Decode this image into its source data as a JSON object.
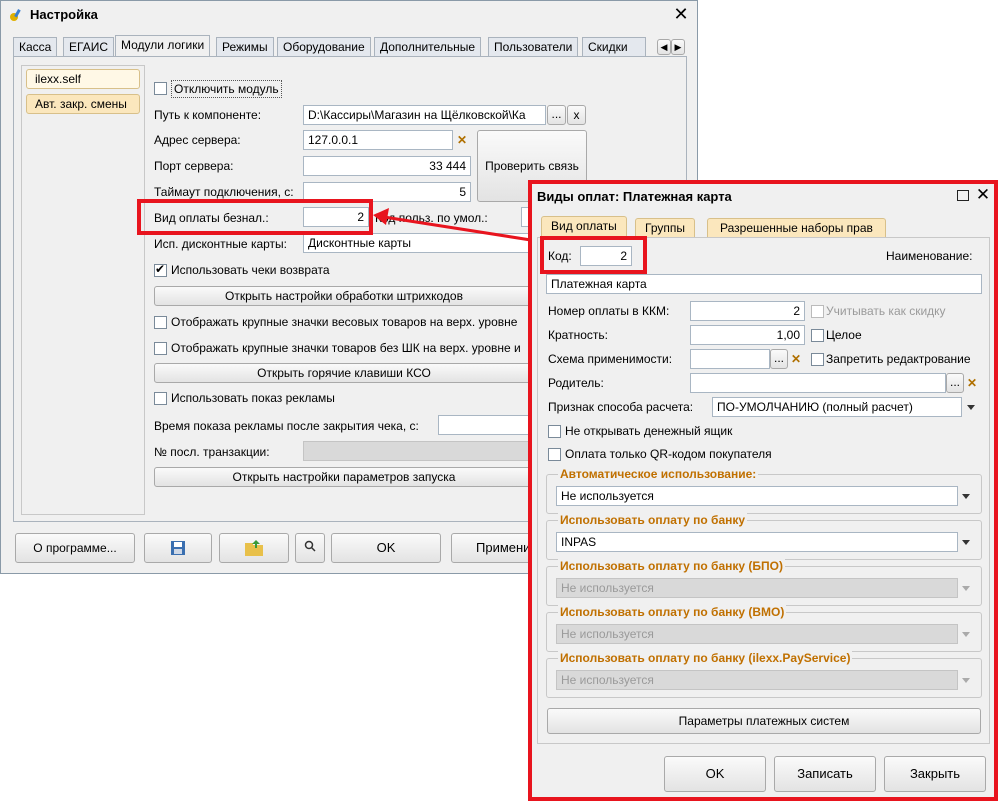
{
  "main": {
    "title": "Настройка",
    "tabs": [
      "Касса",
      "ЕГАИС",
      "Модули логики",
      "Режимы",
      "Оборудование",
      "Дополнительные",
      "Пользователи",
      "Скидки"
    ],
    "side_items": [
      "ilexx.self",
      "Авт. закр. смены"
    ],
    "disable_module": "Отключить модуль",
    "path_label": "Путь к компоненте:",
    "path_value": "D:\\Кассиры\\Магазин на Щёлковской\\Ка",
    "path_browse": "...",
    "path_clear": "x",
    "server_label": "Адрес сервера:",
    "server_value": "127.0.0.1",
    "port_label": "Порт сервера:",
    "port_value": "33 444",
    "check_conn": "Проверить связь",
    "timeout_label": "Таймаут подключения, с:",
    "timeout_value": "5",
    "paytype_label": "Вид оплаты безнал.:",
    "paytype_value": "2",
    "default_user_label": "Код польз. по умол.:",
    "discount_label": "Исп. дисконтные карты:",
    "discount_value": "Дисконтные карты",
    "use_returns": "Использовать чеки возврата",
    "barcode_btn": "Открыть настройки обработки штрихкодов",
    "big_weight_icons": "Отображать крупные значки весовых товаров на верх. уровне",
    "big_nobarcode_icons": "Отображать крупные значки товаров без ШК на верх. уровне и",
    "hotkeys_btn": "Открыть горячие клавиши КСО",
    "use_ads": "Использовать показ рекламы",
    "ads_time_label": "Время показа рекламы после закрытия чека, с:",
    "last_tx_label": "№ посл. транзакции:",
    "launch_btn": "Открыть настройки параметров запуска",
    "about_btn": "О программе...",
    "ok_btn": "OK",
    "apply_btn": "Применить"
  },
  "dialog": {
    "title": "Виды оплат: Платежная карта",
    "tabs": [
      "Вид оплаты",
      "Группы",
      "Разрешенные наборы прав"
    ],
    "code_label": "Код:",
    "code_value": "2",
    "name_label": "Наименование:",
    "name_value": "Платежная карта",
    "kkm_label": "Номер оплаты в ККМ:",
    "kkm_value": "2",
    "as_discount": "Учитывать как скидку",
    "multiplicity_label": "Кратность:",
    "multiplicity_value": "1,00",
    "whole": "Целое",
    "scheme_label": "Схема применимости:",
    "scheme_browse": "...",
    "no_edit": "Запретить редактрование",
    "parent_label": "Родитель:",
    "parent_browse": "...",
    "calc_label": "Признак способа расчета:",
    "calc_value": "ПО-УМОЛЧАНИЮ (полный расчет)",
    "no_drawer": "Не открывать денежный ящик",
    "qr_only": "Оплата только QR-кодом покупателя",
    "auto_use_title": "Автоматическое использование:",
    "auto_use_value": "Не используется",
    "bank_title": "Использовать оплату по банку",
    "bank_value": "INPAS",
    "bpo_title": "Использовать оплату по банку (БПО)",
    "bpo_value": "Не используется",
    "vmo_title": "Использовать оплату по банку (ВМО)",
    "vmo_value": "Не используется",
    "pay_title": "Использовать оплату по банку (ilexx.PayService)",
    "pay_value": "Не используется",
    "params_btn": "Параметры платежных систем",
    "ok_btn": "OK",
    "save_btn": "Записать",
    "close_btn": "Закрыть"
  },
  "colors": {
    "highlight": "#e8141e",
    "group_title": "#c07000"
  }
}
